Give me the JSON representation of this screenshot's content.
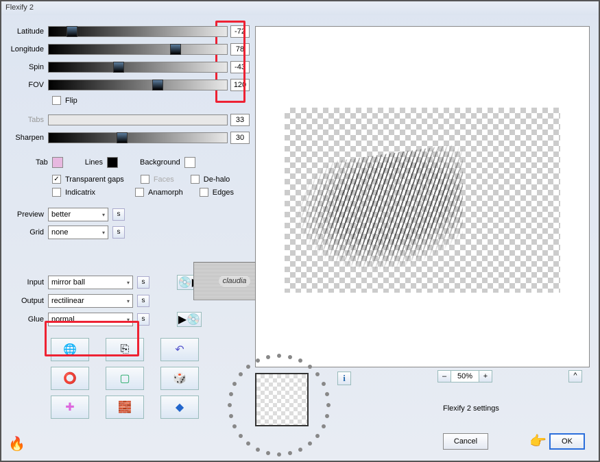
{
  "title": "Flexify 2",
  "sliders": {
    "latitude": {
      "label": "Latitude",
      "value": "-72",
      "pos": 10
    },
    "longitude": {
      "label": "Longitude",
      "value": "78",
      "pos": 68
    },
    "spin": {
      "label": "Spin",
      "value": "-43",
      "pos": 36
    },
    "fov": {
      "label": "FOV",
      "value": "120",
      "pos": 58
    },
    "tabs": {
      "label": "Tabs",
      "value": "33",
      "pos": 0
    },
    "sharpen": {
      "label": "Sharpen",
      "value": "30",
      "pos": 38
    }
  },
  "flip": {
    "label": "Flip",
    "checked": false
  },
  "colors": {
    "tab": {
      "label": "Tab",
      "hex": "#e7b8e0"
    },
    "lines": {
      "label": "Lines",
      "hex": "#000000"
    },
    "background": {
      "label": "Background",
      "hex": "#ffffff"
    }
  },
  "options": {
    "transparent_gaps": {
      "label": "Transparent gaps",
      "checked": true
    },
    "faces": {
      "label": "Faces",
      "checked": false,
      "dim": true
    },
    "dehalo": {
      "label": "De-halo",
      "checked": false
    },
    "indicatrix": {
      "label": "Indicatrix",
      "checked": false
    },
    "anamorph": {
      "label": "Anamorph",
      "checked": false
    },
    "edges": {
      "label": "Edges",
      "checked": false
    }
  },
  "preview": {
    "label": "Preview",
    "value": "better"
  },
  "grid": {
    "label": "Grid",
    "value": "none"
  },
  "input": {
    "label": "Input",
    "value": "mirror ball"
  },
  "output": {
    "label": "Output",
    "value": "rectilinear"
  },
  "glue": {
    "label": "Glue",
    "value": "normal"
  },
  "s": "s",
  "watermark": "claudia",
  "zoom": {
    "minus": "–",
    "value": "50%",
    "plus": "+"
  },
  "caret": "^",
  "settings_label": "Flexify 2 settings",
  "cancel": "Cancel",
  "ok": "OK",
  "info": "i"
}
